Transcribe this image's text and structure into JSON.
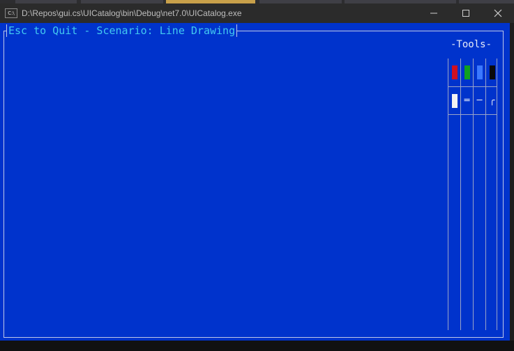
{
  "window": {
    "title": "D:\\Repos\\gui.cs\\UICatalog\\bin\\Debug\\net7.0\\UICatalog.exe",
    "icon": "console-app-icon",
    "icon_text": "C:\\"
  },
  "scenario": {
    "frame_title": "Esc to Quit - Scenario: Line Drawing"
  },
  "tools": {
    "title": "-Tools-",
    "colors": [
      {
        "name": "red",
        "hex": "#d01020"
      },
      {
        "name": "green",
        "hex": "#10a020"
      },
      {
        "name": "blue",
        "hex": "#3b78ff"
      },
      {
        "name": "black",
        "hex": "#0a0a0a"
      },
      {
        "name": "white",
        "hex": "#f2f2f2"
      }
    ],
    "styles": [
      {
        "name": "double-line",
        "glyph": "═"
      },
      {
        "name": "single-line",
        "glyph": "─"
      },
      {
        "name": "rounded",
        "glyph": "╭"
      }
    ]
  },
  "theme": {
    "console_bg": "#0033cc",
    "title_text_color": "#42c8f0"
  }
}
